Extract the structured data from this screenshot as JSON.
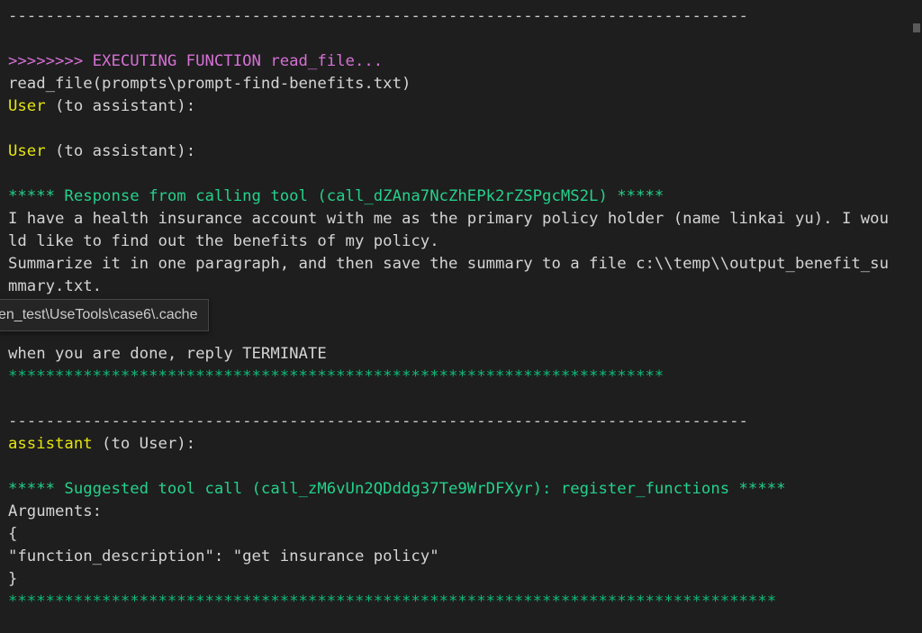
{
  "terminal": {
    "lines": [
      {
        "text": "-------------------------------------------------------------------------------",
        "kind": "sep"
      },
      {
        "text": "",
        "kind": "plain"
      },
      {
        "text": ">>>>>>>> EXECUTING FUNCTION read_file...",
        "kind": "exec"
      },
      {
        "text": "read_file(prompts\\prompt-find-benefits.txt)",
        "kind": "plain"
      },
      {
        "speaker": "User",
        "rest": " (to assistant):",
        "kind": "speaker"
      },
      {
        "text": "",
        "kind": "plain"
      },
      {
        "speaker": "User",
        "rest": " (to assistant):",
        "kind": "speaker"
      },
      {
        "text": "",
        "kind": "plain"
      },
      {
        "text": "***** Response from calling tool (call_dZAna7NcZhEPk2rZSPgcMS2L) *****",
        "kind": "green"
      },
      {
        "text": "I have a health insurance account with me as the primary policy holder (name linkai yu). I wou",
        "kind": "plain"
      },
      {
        "text": "ld like to find out the benefits of my policy.",
        "kind": "plain"
      },
      {
        "text": "Summarize it in one paragraph, and then save the summary to a file c:\\\\temp\\\\output_benefit_su",
        "kind": "plain"
      },
      {
        "text": "mmary.txt.",
        "kind": "plain"
      },
      {
        "text": "",
        "kind": "plain"
      },
      {
        "text": "",
        "kind": "plain"
      },
      {
        "text": "when you are done, reply TERMINATE",
        "kind": "plain"
      },
      {
        "text": "**********************************************************************",
        "kind": "stars"
      },
      {
        "text": "",
        "kind": "plain"
      },
      {
        "text": "-------------------------------------------------------------------------------",
        "kind": "sep"
      },
      {
        "speaker": "assistant",
        "rest": " (to User):",
        "kind": "speaker"
      },
      {
        "text": "",
        "kind": "plain"
      },
      {
        "text": "***** Suggested tool call (call_zM6vUn2QDddg37Te9WrDFXyr): register_functions *****",
        "kind": "green"
      },
      {
        "text": "Arguments:",
        "kind": "plain"
      },
      {
        "text": "{",
        "kind": "plain"
      },
      {
        "text": "\"function_description\": \"get insurance policy\"",
        "kind": "plain"
      },
      {
        "text": "}",
        "kind": "plain"
      },
      {
        "text": "**********************************************************************************",
        "kind": "stars"
      }
    ]
  },
  "tooltip": {
    "text": "en_test\\UseTools\\case6\\.cache"
  },
  "colors": {
    "background": "#1e1e1e",
    "text": "#d4d4d4",
    "exec": "#d670d6",
    "speaker": "#e5e510",
    "tool_header": "#23d18b",
    "stars": "#0dbc79"
  }
}
